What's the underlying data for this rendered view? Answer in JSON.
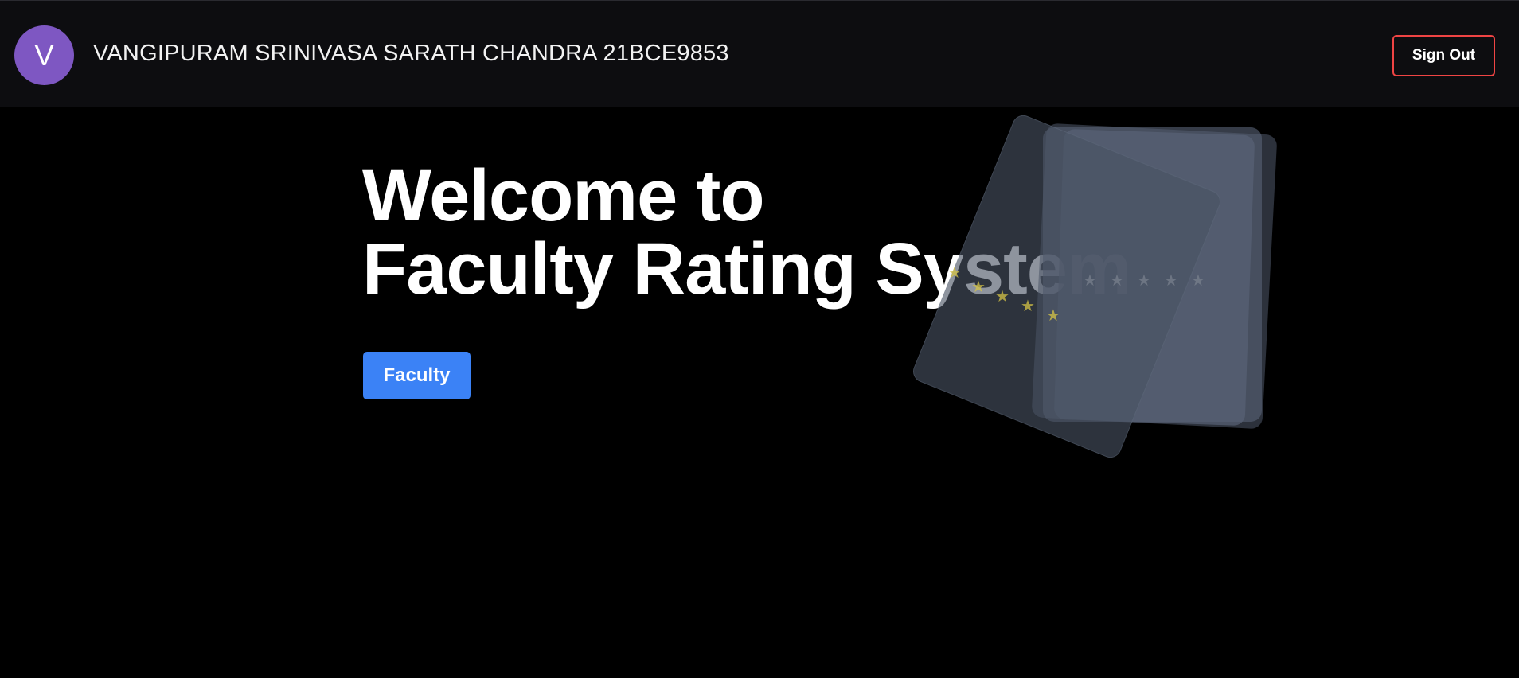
{
  "header": {
    "avatar_initial": "V",
    "user_name": "VANGIPURAM SRINIVASA SARATH CHANDRA 21BCE9853",
    "signout_label": "Sign Out"
  },
  "hero": {
    "title_line1": "Welcome to",
    "title_line2": "Faculty Rating System",
    "faculty_button_label": "Faculty"
  },
  "illustration": {
    "icon": "rating-cards-illustration",
    "star_char": "★"
  },
  "colors": {
    "background": "#000000",
    "topbar": "#0d0d10",
    "avatar": "#7e57c2",
    "signout_border": "#ef4444",
    "primary_button": "#3b82f6"
  }
}
